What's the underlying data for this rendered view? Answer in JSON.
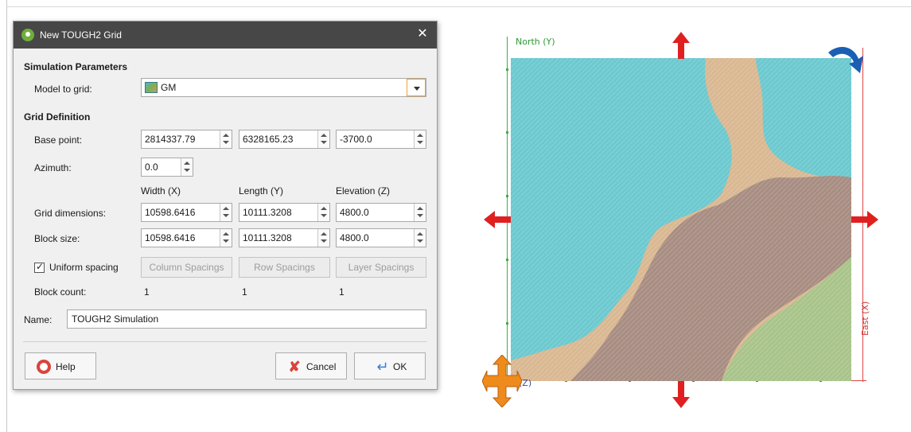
{
  "dialog": {
    "title": "New TOUGH2 Grid",
    "close_glyph": "✕",
    "simulation_parameters": "Simulation Parameters",
    "model_to_grid_label": "Model to grid:",
    "model_to_grid_value": "GM",
    "grid_definition": "Grid Definition",
    "base_point_label": "Base point:",
    "base_point": [
      "2814337.79",
      "6328165.23",
      "-3700.0"
    ],
    "azimuth_label": "Azimuth:",
    "azimuth": "0.0",
    "col_headers": [
      "Width (X)",
      "Length (Y)",
      "Elevation (Z)"
    ],
    "grid_dimensions_label": "Grid dimensions:",
    "grid_dimensions": [
      "10598.6416",
      "10111.3208",
      "4800.0"
    ],
    "block_size_label": "Block size:",
    "block_size": [
      "10598.6416",
      "10111.3208",
      "4800.0"
    ],
    "uniform_spacing_label": "Uniform spacing",
    "uniform_spacing_checked": true,
    "column_spacings": "Column Spacings",
    "row_spacings": "Row Spacings",
    "layer_spacings": "Layer Spacings",
    "block_count_label": "Block count:",
    "block_count": [
      "1",
      "1",
      "1"
    ],
    "name_label": "Name:",
    "name_value": "TOUGH2 Simulation",
    "help": "Help",
    "cancel": "Cancel",
    "ok": "OK"
  },
  "viewer": {
    "north_label": "North (Y)",
    "east_label": "East (X)",
    "elev_label": "(Z)",
    "colors": {
      "cyan_unit": "#6cc9cf",
      "tan_unit": "#d9b892",
      "brown_unit": "#a88d82",
      "green_unit": "#a9c48a",
      "arrow_red": "#e02020",
      "arrow_orange": "#ef8a1c",
      "rotate_blue": "#1a5fb4"
    }
  }
}
